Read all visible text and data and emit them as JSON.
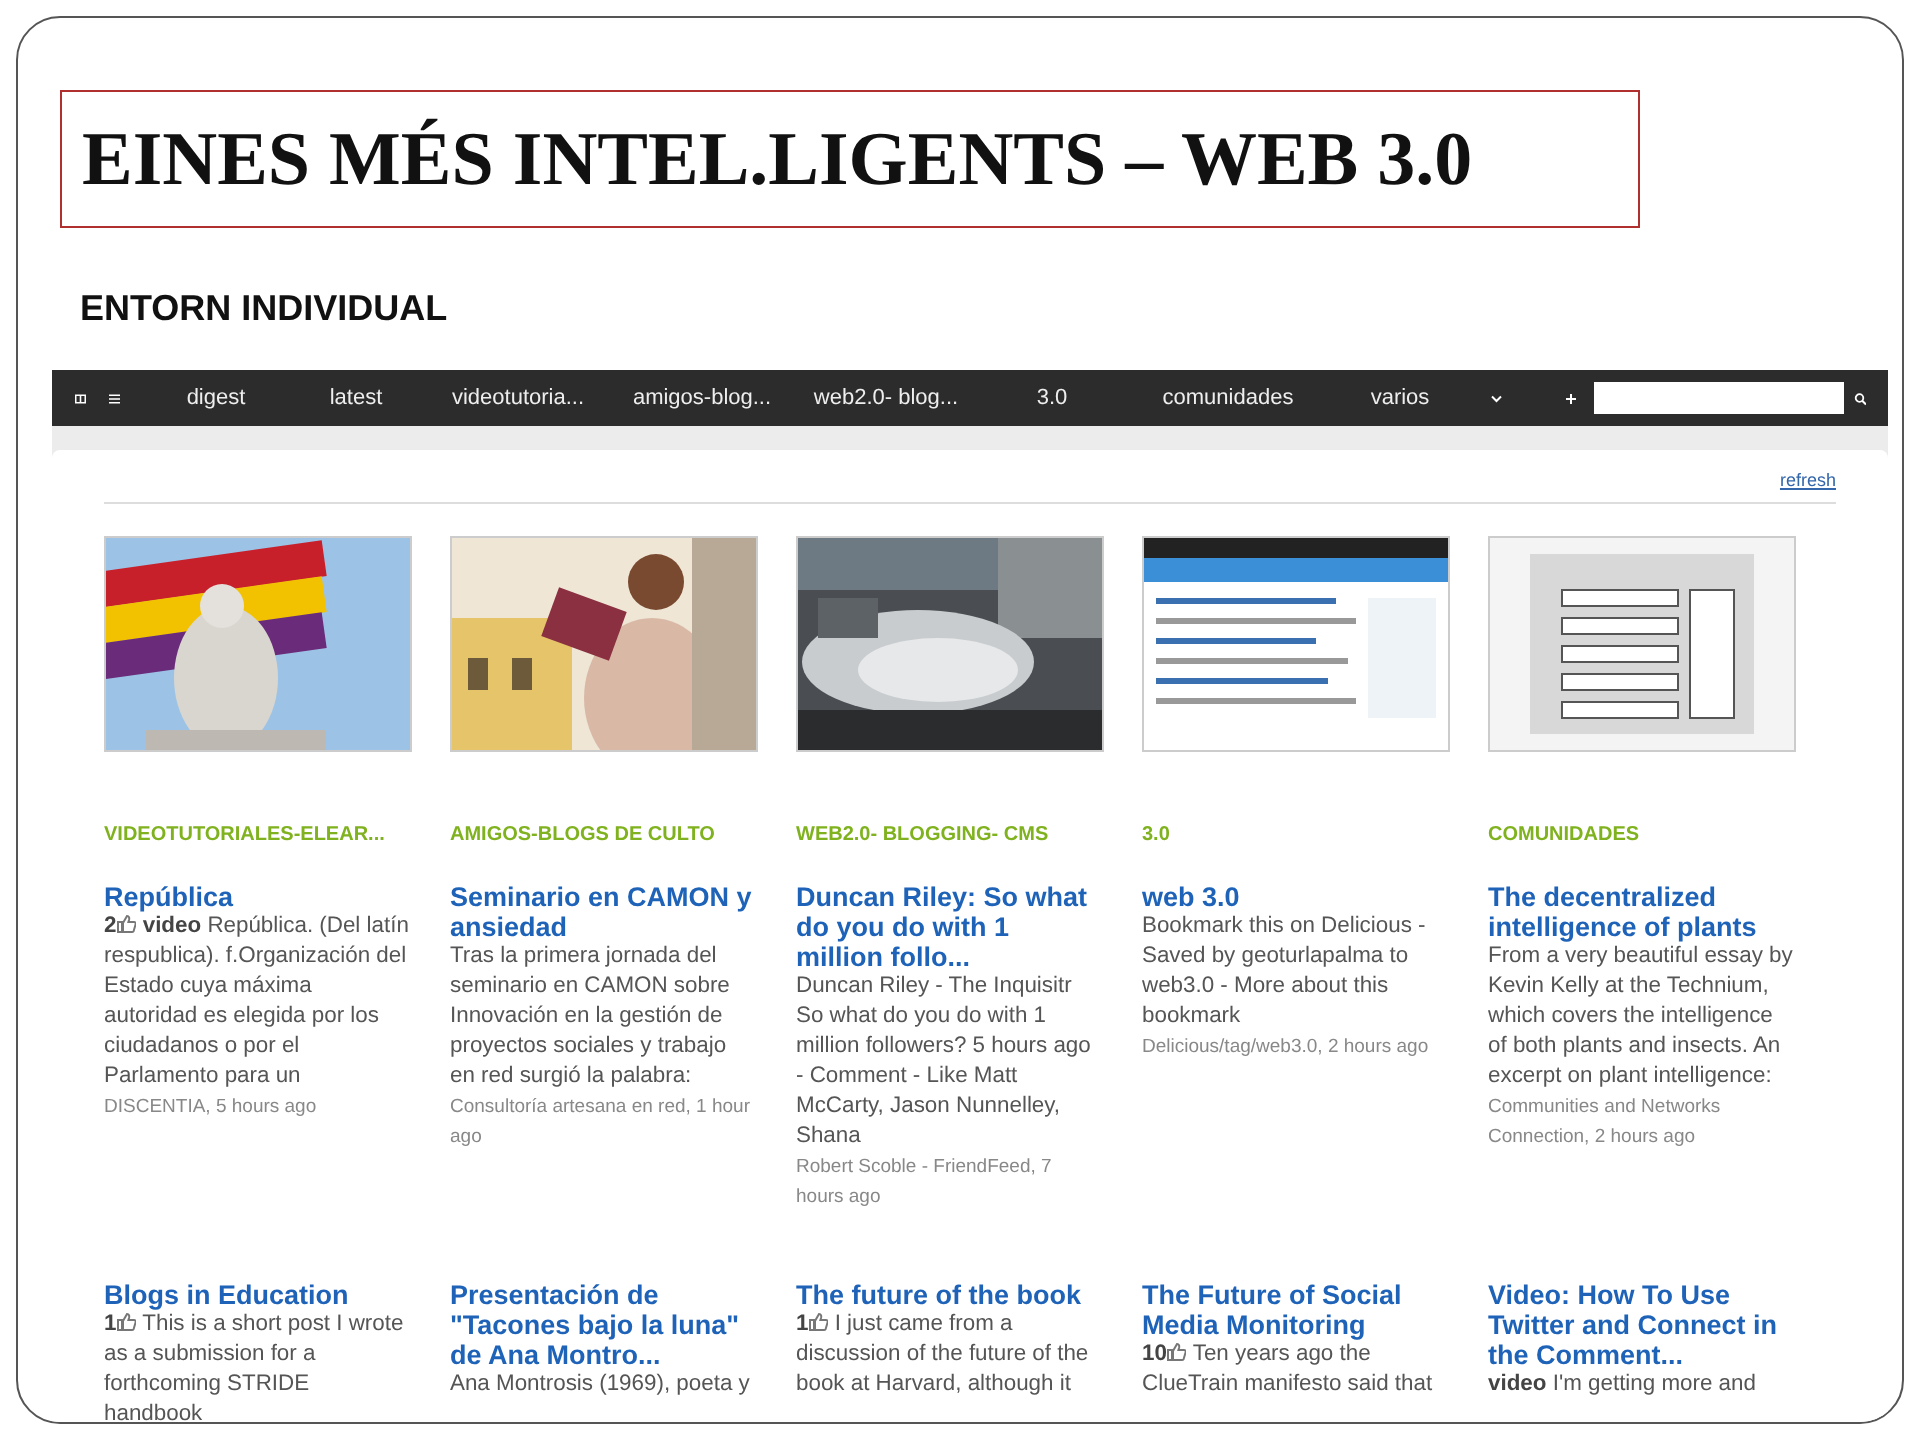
{
  "slide": {
    "title": "EINES MÉS INTEL.LIGENTS – WEB 3.0",
    "subtitle": "ENTORN INDIVIDUAL"
  },
  "navbar": {
    "tabs": [
      {
        "label": "digest"
      },
      {
        "label": "latest"
      },
      {
        "label": "videotutoria..."
      },
      {
        "label": "amigos-blog..."
      },
      {
        "label": "web2.0- blog..."
      },
      {
        "label": "3.0"
      },
      {
        "label": "comunidades"
      },
      {
        "label": "varios"
      }
    ]
  },
  "refresh": "refresh",
  "row_1": [
    {
      "category": "VIDEOTUTORIALES-ELEAR...",
      "title": "República",
      "likes": "2",
      "tag": "video",
      "body": "República. (Del latín respublica). f.Organización del Estado cuya máxima autoridad es elegida por los ciudadanos o por el Parlamento para un",
      "source": "DISCENTIA, 5 hours ago"
    },
    {
      "category": "AMIGOS-BLOGS DE CULTO",
      "title": "Seminario en CAMON y ansiedad",
      "body": "Tras la primera jornada del seminario en CAMON sobre Innovación en la gestión de proyectos sociales y trabajo en red surgió la palabra:",
      "source": "Consultoría artesana en red, 1 hour ago"
    },
    {
      "category": "WEB2.0- BLOGGING- CMS",
      "title": "Duncan Riley: So what do you do with 1 million follo...",
      "body": "Duncan Riley - The Inquisitr So what do you do with 1 million followers? 5 hours ago - Comment - Like Matt McCarty, Jason Nunnelley, Shana",
      "source": "Robert Scoble - FriendFeed, 7 hours ago"
    },
    {
      "category": "3.0",
      "title": "web 3.0",
      "body": "Bookmark this on Delicious - Saved by geoturlapalma to web3.0 - More about this bookmark",
      "source": "Delicious/tag/web3.0, 2 hours ago"
    },
    {
      "category": "COMUNIDADES",
      "title": "The decentralized intelligence of plants",
      "body": "From a very beautiful essay by Kevin Kelly at the Technium, which covers the intelligence of both plants and insects. An excerpt on plant intelligence:",
      "source": "Communities and Networks Connection, 2 hours ago"
    }
  ],
  "row_2": [
    {
      "title": "Blogs in Education",
      "likes": "1",
      "body": "This is a short post I wrote as a submission for a forthcoming STRIDE handbook"
    },
    {
      "title": "Presentación de \"Tacones bajo la luna\" de Ana Montro...",
      "body": "Ana Montrosis (1969), poeta y"
    },
    {
      "title": "The future of the book",
      "likes": "1",
      "body": "I just came from a discussion of the future of the book at Harvard, although it"
    },
    {
      "title": "The Future of Social Media Monitoring",
      "likes": "10",
      "body": "Ten years ago the ClueTrain manifesto said that"
    },
    {
      "title": "Video: How To Use Twitter and Connect in the Comment...",
      "tag": "video",
      "body": "I'm getting more and"
    }
  ]
}
